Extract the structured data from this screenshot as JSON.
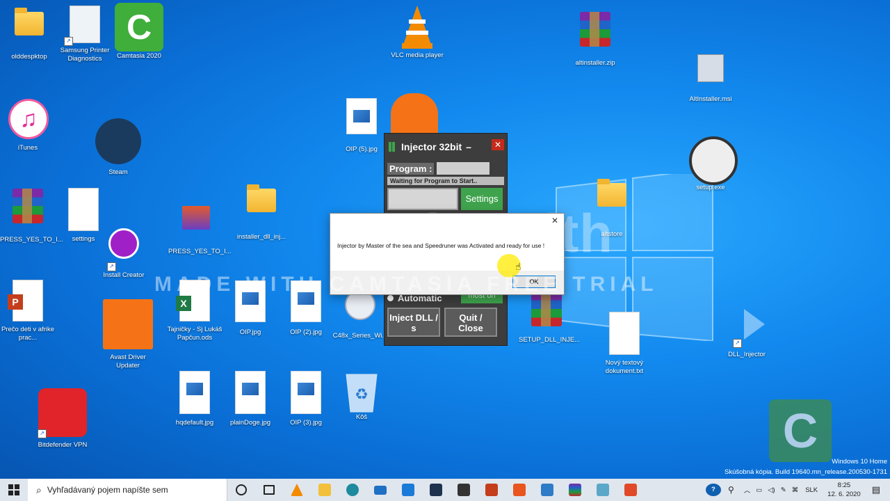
{
  "desktop": {
    "icons": [
      {
        "label": "olddespktop"
      },
      {
        "label": "Samsung Printer Diagnostics"
      },
      {
        "label": "Camtasia 2020"
      },
      {
        "label": "VLC media player"
      },
      {
        "label": "altinstaller.zip"
      },
      {
        "label": "AltInstaller.msi"
      },
      {
        "label": "iTunes"
      },
      {
        "label": "Steam"
      },
      {
        "label": "OIP (5).jpg"
      },
      {
        "label": "setup.exe"
      },
      {
        "label": "PRESS_YES_TO_I..."
      },
      {
        "label": "settings"
      },
      {
        "label": "Install Creator"
      },
      {
        "label": "PRESS_YES_TO_I..."
      },
      {
        "label": "installer_dll_inj..."
      },
      {
        "label": "altstore"
      },
      {
        "label": "Prečo deti v afrike prac..."
      },
      {
        "label": "Avast Driver Updater"
      },
      {
        "label": "Tajničky - Sj Lukáš Papčun.ods"
      },
      {
        "label": "OIP.jpg"
      },
      {
        "label": "OIP (2).jpg"
      },
      {
        "label": "C48x_Series_Wi..."
      },
      {
        "label": "SETUP_DLL_INJE..."
      },
      {
        "label": "Nový textový dokument.txt"
      },
      {
        "label": "DLL_Injector"
      },
      {
        "label": "hqdefault.jpg"
      },
      {
        "label": "plainDoge.jpg"
      },
      {
        "label": "OIP (3).jpg"
      },
      {
        "label": "Kôš"
      },
      {
        "label": "Bitdefender VPN"
      }
    ]
  },
  "injector": {
    "title": "Injector 32bit",
    "minimize": "–",
    "close": "✕",
    "program_label": "Program :",
    "status": "Waiting for Program to Start..",
    "settings_button": "Settings",
    "automatic_label": "Automatic",
    "most_on_label": "most on",
    "inject_button": "Inject DLL / s",
    "quit_button": "Quit / Close"
  },
  "dialog": {
    "message": "Injector by Master of the sea and Speedruner was Activated and ready for use !",
    "ok_button": "OK",
    "close": "✕"
  },
  "watermark": {
    "brand": "TechSmith",
    "trial": "MADE WITH CAMTASIA FREE TRIAL"
  },
  "taskbar": {
    "search_placeholder": "Vyhľadávaný pojem napíšte sem",
    "language": "SLK",
    "time": "8:25",
    "date": "12. 6. 2020"
  },
  "windows_info": {
    "edition": "Windows 10 Home",
    "build": "Skúšobná kópia. Build 19640.mn_release.200530-1731"
  },
  "colors": {
    "accent": "#0078d7",
    "injector_bg": "#3d3d3d",
    "injector_green": "#3fa34d",
    "close_red": "#c42b1c"
  }
}
